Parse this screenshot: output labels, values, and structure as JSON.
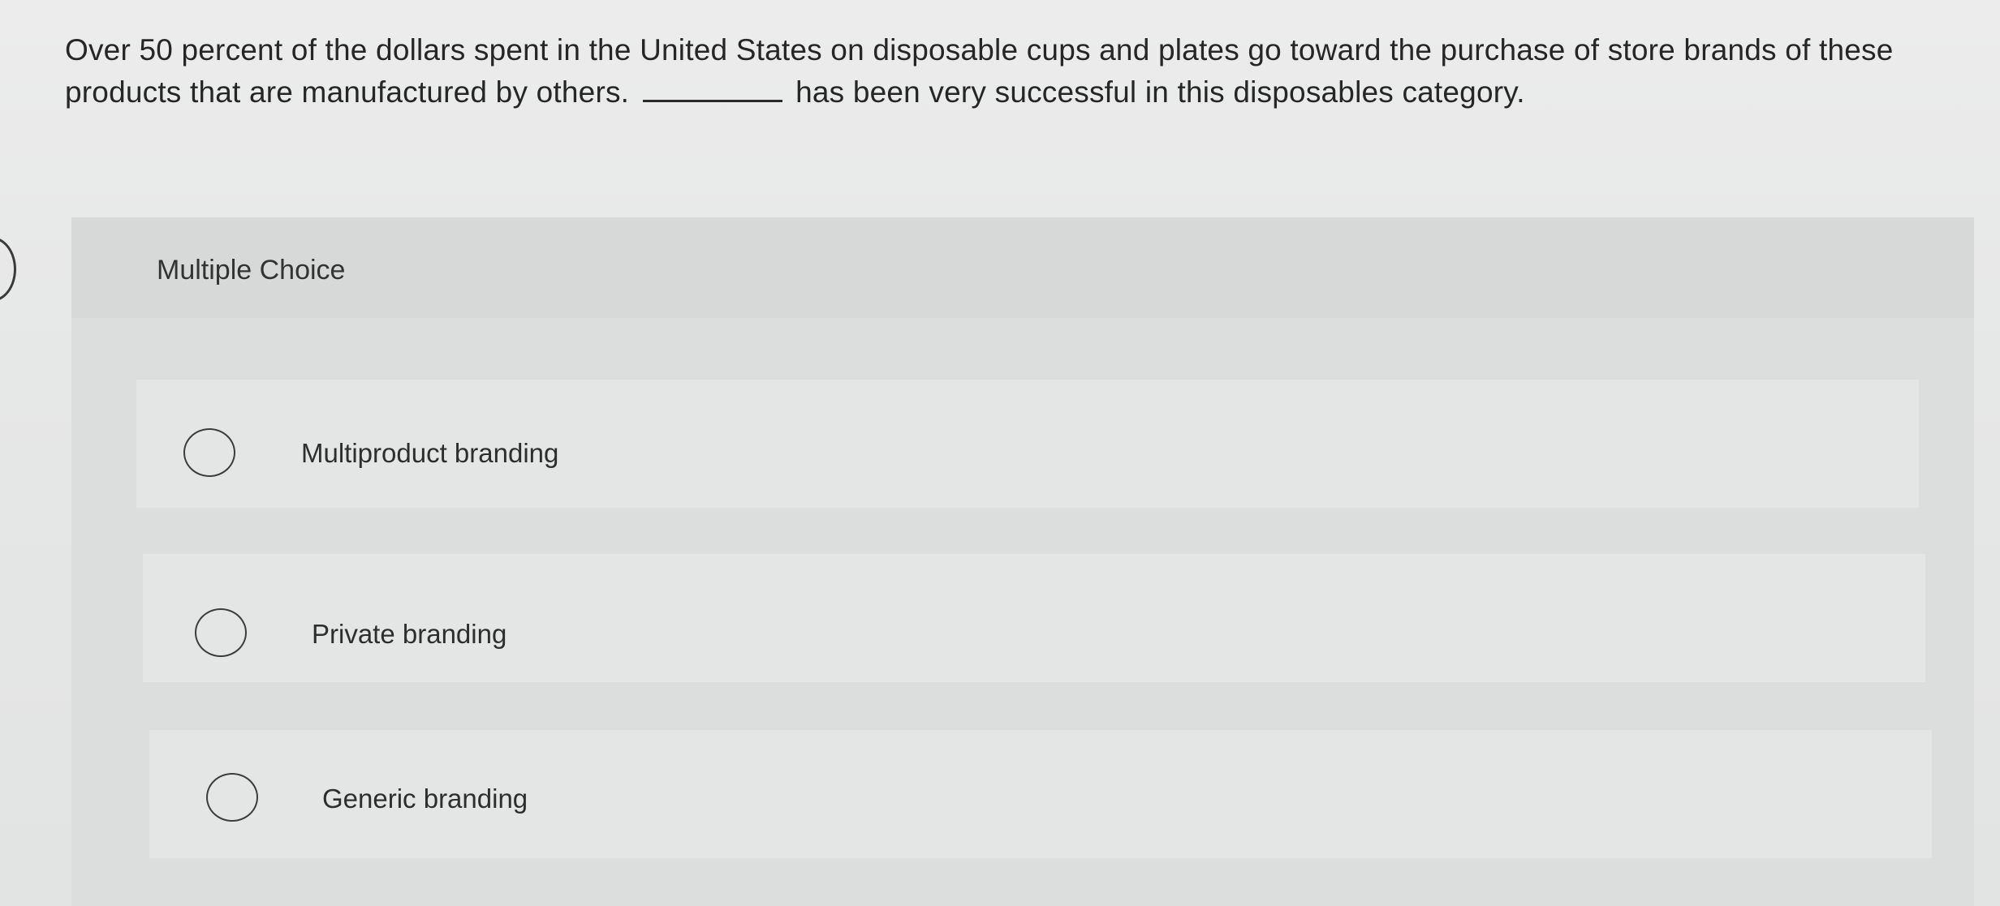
{
  "question": {
    "part1": "Over 50 percent of the dollars spent in the United States on disposable cups and plates go toward the purchase of store brands of these products that are manufactured by others.",
    "part2": "has been very successful in this disposables category."
  },
  "multiple_choice": {
    "heading": "Multiple Choice",
    "options": [
      {
        "label": "Multiproduct branding",
        "selected": false
      },
      {
        "label": "Private branding",
        "selected": false
      },
      {
        "label": "Generic branding",
        "selected": false
      }
    ]
  }
}
